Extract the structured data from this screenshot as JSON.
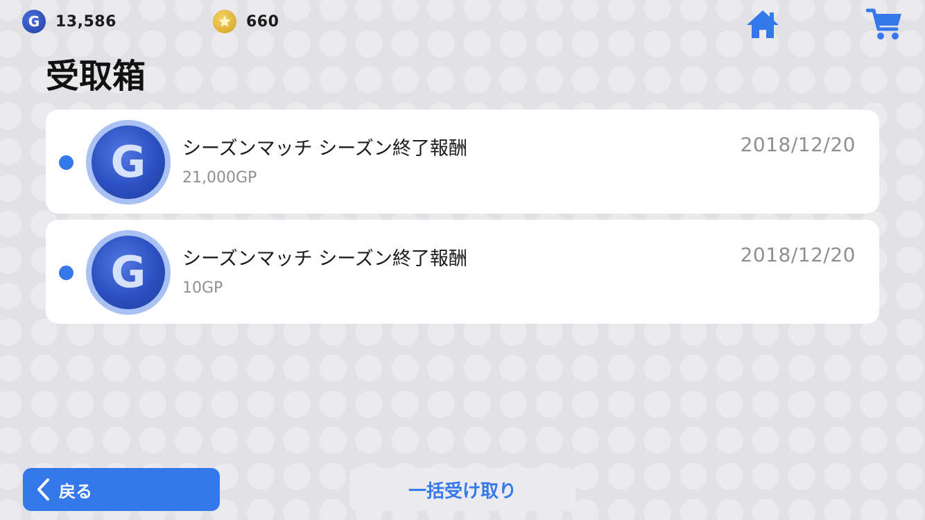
{
  "header": {
    "gp_icon_letter": "G",
    "gp_amount": "13,586",
    "coin_amount": "660",
    "home_icon": "home-icon",
    "cart_icon": "cart-icon"
  },
  "page": {
    "title": "受取箱"
  },
  "inbox": {
    "items": [
      {
        "title": "シーズンマッチ シーズン終了報酬",
        "amount": "21,000GP",
        "date": "2018/12/20",
        "icon_letter": "G",
        "unread": true
      },
      {
        "title": "シーズンマッチ シーズン終了報酬",
        "amount": "10GP",
        "date": "2018/12/20",
        "icon_letter": "G",
        "unread": true
      }
    ]
  },
  "footer": {
    "back_label": "戻る",
    "receive_all_label": "一括受け取り"
  },
  "colors": {
    "accent": "#3478ec",
    "background": "#e2e2e6",
    "card": "#ffffff",
    "secondary_text": "#8f8f8f"
  }
}
